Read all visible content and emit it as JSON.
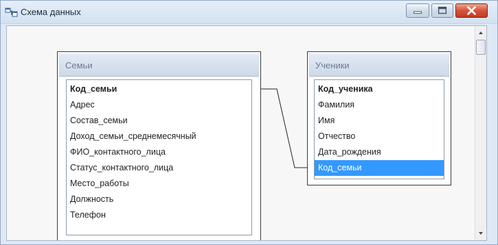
{
  "window": {
    "title": "Схема данных",
    "icon": "relationships-icon",
    "buttons": [
      "minimize",
      "maximize",
      "close"
    ]
  },
  "tables": [
    {
      "name": "Семьи",
      "fields": [
        "Код_семьи",
        "Адрес",
        "Состав_семьи",
        "Доход_семьи_среднемесячный",
        "ФИО_контактного_лица",
        "Статус_контактного_лица",
        "Место_работы",
        "Должность",
        "Телефон"
      ],
      "key_field": "Код_семьи"
    },
    {
      "name": "Ученики",
      "fields": [
        "Код_ученика",
        "Фамилия",
        "Имя",
        "Отчество",
        "Дата_рождения",
        "Код_семьи"
      ],
      "key_field": "Код_ученика",
      "selected_field": "Код_семьи"
    }
  ],
  "relationship": {
    "from": "Семьи.Код_семьи",
    "to": "Ученики.Код_семьи"
  },
  "colors": {
    "selection": "#3399ff",
    "close_button": "#c23a20",
    "header": "#cdd9e8"
  }
}
